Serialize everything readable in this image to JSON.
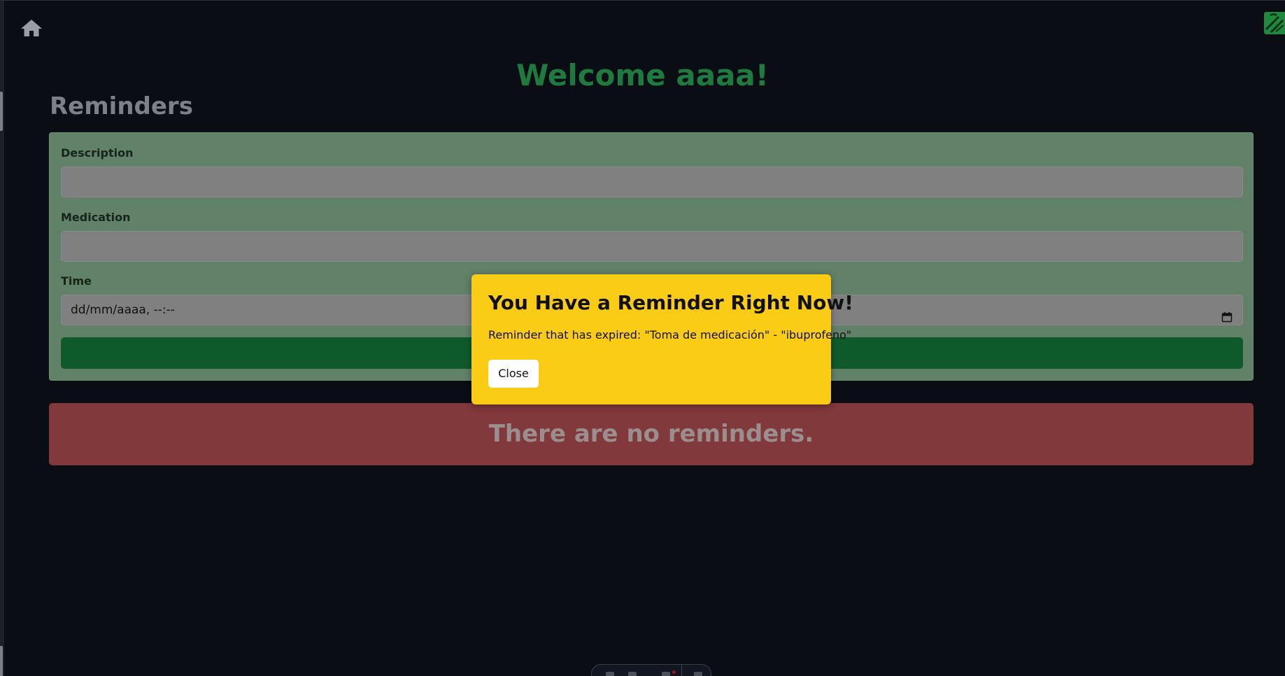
{
  "header": {
    "welcome_text": "Welcome aaaa!",
    "home_icon": "home-icon",
    "corner_icon": "extension-badge-icon"
  },
  "reminders": {
    "section_title": "Reminders",
    "form": {
      "description_label": "Description",
      "description_value": "",
      "medication_label": "Medication",
      "medication_value": "",
      "time_label": "Time",
      "time_placeholder": "dd/mm/aaaa, --:--",
      "calendar_icon": "calendar-icon",
      "submit_label": ""
    },
    "empty_message": "There are no reminders."
  },
  "modal": {
    "title": "You Have a Reminder Right Now!",
    "message": "Reminder that has expired: \"Toma de medicación\" - \"ibuprofeno\"",
    "close_label": "Close"
  },
  "colors": {
    "background": "#0a0d14",
    "welcome": "#1f7a3f",
    "form_card": "#618169",
    "input": "#808080",
    "submit": "#0f5a2a",
    "empty_banner": "#81393b",
    "modal": "#facc15"
  }
}
